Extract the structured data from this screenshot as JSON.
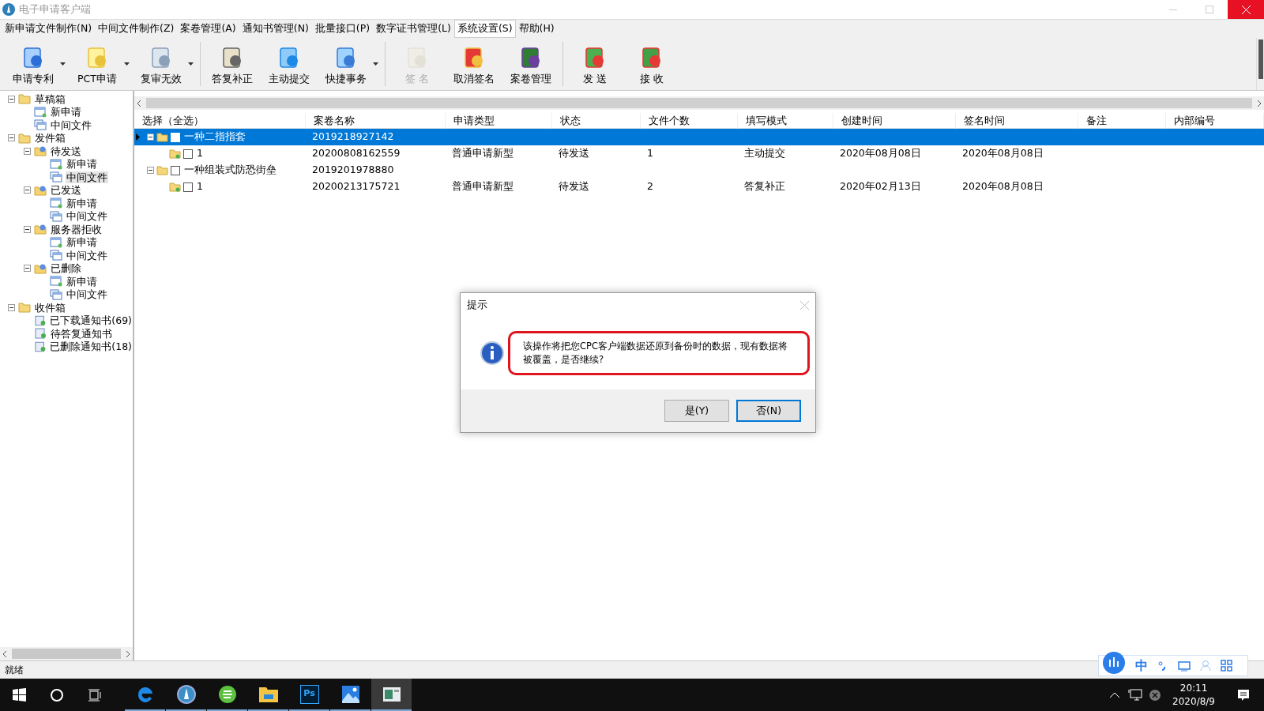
{
  "window": {
    "title": "电子申请客户端"
  },
  "menu": [
    {
      "label": "新申请文件制作(N)",
      "selected": false
    },
    {
      "label": "中间文件制作(Z)",
      "selected": false
    },
    {
      "label": "案卷管理(A)",
      "selected": false
    },
    {
      "label": "通知书管理(N)",
      "selected": false
    },
    {
      "label": "批量接口(P)",
      "selected": false
    },
    {
      "label": "数字证书管理(L)",
      "selected": false
    },
    {
      "label": "系统设置(S)",
      "selected": true
    },
    {
      "label": "帮助(H)",
      "selected": false
    }
  ],
  "toolbar": [
    [
      {
        "label": "申请专利",
        "dropdown": true,
        "disabled": false
      },
      {
        "label": "PCT申请",
        "dropdown": true,
        "disabled": false
      },
      {
        "label": "复审无效",
        "dropdown": true,
        "disabled": false
      }
    ],
    [
      {
        "label": "答复补正",
        "dropdown": false,
        "disabled": false
      },
      {
        "label": "主动提交",
        "dropdown": false,
        "disabled": false
      },
      {
        "label": "快捷事务",
        "dropdown": true,
        "disabled": false
      }
    ],
    [
      {
        "label": "签 名",
        "dropdown": false,
        "disabled": true
      },
      {
        "label": "取消签名",
        "dropdown": false,
        "disabled": false
      },
      {
        "label": "案卷管理",
        "dropdown": false,
        "disabled": false
      }
    ],
    [
      {
        "label": "发 送",
        "dropdown": false,
        "disabled": false
      },
      {
        "label": "接 收",
        "dropdown": false,
        "disabled": false
      }
    ]
  ],
  "tree": [
    {
      "label": "草稿箱",
      "kind": "folder",
      "expanded": true,
      "selected": false,
      "children": [
        {
          "label": "新申请",
          "kind": "page",
          "selected": false
        },
        {
          "label": "中间文件",
          "kind": "pages",
          "selected": false
        }
      ]
    },
    {
      "label": "发件箱",
      "kind": "folder",
      "expanded": true,
      "selected": false,
      "children": [
        {
          "label": "待发送",
          "kind": "box",
          "expanded": true,
          "selected": false,
          "children": [
            {
              "label": "新申请",
              "kind": "page",
              "selected": false
            },
            {
              "label": "中间文件",
              "kind": "pages",
              "selected": true
            }
          ]
        },
        {
          "label": "已发送",
          "kind": "box",
          "expanded": true,
          "selected": false,
          "children": [
            {
              "label": "新申请",
              "kind": "page",
              "selected": false
            },
            {
              "label": "中间文件",
              "kind": "pages",
              "selected": false
            }
          ]
        },
        {
          "label": "服务器拒收",
          "kind": "box",
          "expanded": true,
          "selected": false,
          "children": [
            {
              "label": "新申请",
              "kind": "page",
              "selected": false
            },
            {
              "label": "中间文件",
              "kind": "pages",
              "selected": false
            }
          ]
        },
        {
          "label": "已删除",
          "kind": "box",
          "expanded": true,
          "selected": false,
          "children": [
            {
              "label": "新申请",
              "kind": "page",
              "selected": false
            },
            {
              "label": "中间文件",
              "kind": "pages",
              "selected": false
            }
          ]
        }
      ]
    },
    {
      "label": "收件箱",
      "kind": "folder",
      "expanded": true,
      "selected": false,
      "children": [
        {
          "label": "已下载通知书(69)",
          "kind": "notice",
          "selected": false
        },
        {
          "label": "待答复通知书",
          "kind": "notice",
          "selected": false
        },
        {
          "label": "已删除通知书(18)",
          "kind": "notice",
          "selected": false
        }
      ]
    }
  ],
  "table": {
    "columns": [
      "选择（全选）",
      "案卷名称",
      "申请类型",
      "状态",
      "文件个数",
      "填写模式",
      "创建时间",
      "签名时间",
      "备注",
      "内部编号"
    ],
    "rows": [
      {
        "kind": "group",
        "selected": true,
        "current": true,
        "checked": false,
        "expanded": true,
        "cells": [
          "一种二指指套",
          "2019218927142"
        ]
      },
      {
        "kind": "item",
        "selected": false,
        "current": false,
        "checked": false,
        "cells": [
          "1",
          "20200808162559",
          "普通申请新型",
          "待发送",
          "1",
          "主动提交",
          "2020年08月08日",
          "2020年08月08日"
        ]
      },
      {
        "kind": "group",
        "selected": false,
        "current": false,
        "checked": false,
        "expanded": true,
        "cells": [
          "一种组装式防恐街垒",
          "2019201978880"
        ]
      },
      {
        "kind": "item",
        "selected": false,
        "current": false,
        "checked": false,
        "cells": [
          "1",
          "20200213175721",
          "普通申请新型",
          "待发送",
          "2",
          "答复补正",
          "2020年02月13日",
          "2020年08月08日"
        ]
      }
    ]
  },
  "dialog": {
    "title": "提示",
    "message": "该操作将把您CPC客户端数据还原到备份时的数据，现有数据将被覆盖，是否继续?",
    "buttons": [
      "是(Y)",
      "否(N)"
    ]
  },
  "status_bar": "就绪",
  "ime": {
    "mode": "中"
  },
  "taskbar": {
    "apps": [
      {
        "kind": "edge",
        "selected": false
      },
      {
        "kind": "client",
        "selected": false
      },
      {
        "kind": "browser",
        "selected": false
      },
      {
        "kind": "files",
        "selected": false
      },
      {
        "kind": "ps",
        "label": "Ps",
        "selected": false
      },
      {
        "kind": "photos",
        "selected": false
      },
      {
        "kind": "window",
        "selected": true
      }
    ],
    "time": "20:11",
    "date": "2020/8/9"
  }
}
